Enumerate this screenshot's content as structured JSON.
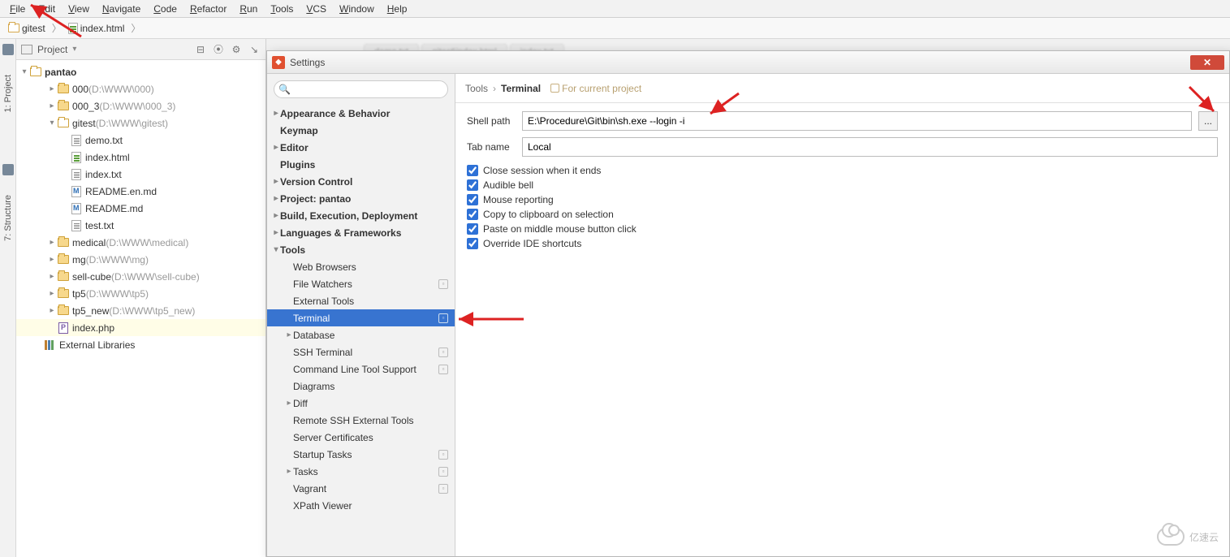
{
  "menubar": [
    "File",
    "Edit",
    "View",
    "Navigate",
    "Code",
    "Refactor",
    "Run",
    "Tools",
    "VCS",
    "Window",
    "Help"
  ],
  "breadcrumb": {
    "project": "gitest",
    "file": "index.html"
  },
  "leftrail": {
    "project": "1: Project",
    "structure": "7: Structure"
  },
  "project_panel": {
    "title": "Project",
    "root": "pantao",
    "items": [
      {
        "type": "folder",
        "arrow": "right",
        "name": "000",
        "hint": "(D:\\WWW\\000)",
        "indent": 1
      },
      {
        "type": "folder",
        "arrow": "right",
        "name": "000_3",
        "hint": "(D:\\WWW\\000_3)",
        "indent": 1
      },
      {
        "type": "folder",
        "arrow": "down",
        "name": "gitest",
        "hint": "(D:\\WWW\\gitest)",
        "indent": 1,
        "open": true
      },
      {
        "type": "file",
        "kind": "txt",
        "name": "demo.txt",
        "indent": 2
      },
      {
        "type": "file",
        "kind": "html",
        "name": "index.html",
        "indent": 2
      },
      {
        "type": "file",
        "kind": "txt",
        "name": "index.txt",
        "indent": 2
      },
      {
        "type": "file",
        "kind": "md",
        "name": "README.en.md",
        "indent": 2
      },
      {
        "type": "file",
        "kind": "md",
        "name": "README.md",
        "indent": 2
      },
      {
        "type": "file",
        "kind": "txt",
        "name": "test.txt",
        "indent": 2
      },
      {
        "type": "folder",
        "arrow": "right",
        "name": "medical",
        "hint": "(D:\\WWW\\medical)",
        "indent": 1
      },
      {
        "type": "folder",
        "arrow": "right",
        "name": "mg",
        "hint": "(D:\\WWW\\mg)",
        "indent": 1
      },
      {
        "type": "folder",
        "arrow": "right",
        "name": "sell-cube",
        "hint": "(D:\\WWW\\sell-cube)",
        "indent": 1
      },
      {
        "type": "folder",
        "arrow": "right",
        "name": "tp5",
        "hint": "(D:\\WWW\\tp5)",
        "indent": 1
      },
      {
        "type": "folder",
        "arrow": "right",
        "name": "tp5_new",
        "hint": "(D:\\WWW\\tp5_new)",
        "indent": 1
      },
      {
        "type": "file",
        "kind": "php",
        "name": "index.php",
        "indent": 1,
        "selected": true
      },
      {
        "type": "lib",
        "name": "External Libraries",
        "indent": 0
      }
    ]
  },
  "editor_tabs": [
    "demo.txt",
    "gitest\\index.html",
    "index.txt"
  ],
  "dialog": {
    "title": "Settings",
    "close": "✕",
    "search_placeholder": "",
    "nav": [
      {
        "label": "Appearance & Behavior",
        "bold": true,
        "arrow": "right",
        "ind": 0
      },
      {
        "label": "Keymap",
        "bold": true,
        "ind": 0
      },
      {
        "label": "Editor",
        "bold": true,
        "arrow": "right",
        "ind": 0
      },
      {
        "label": "Plugins",
        "bold": true,
        "ind": 0
      },
      {
        "label": "Version Control",
        "bold": true,
        "arrow": "right",
        "ind": 0
      },
      {
        "label": "Project: pantao",
        "bold": true,
        "arrow": "right",
        "ind": 0
      },
      {
        "label": "Build, Execution, Deployment",
        "bold": true,
        "arrow": "right",
        "ind": 0
      },
      {
        "label": "Languages & Frameworks",
        "bold": true,
        "arrow": "right",
        "ind": 0
      },
      {
        "label": "Tools",
        "bold": true,
        "arrow": "down",
        "ind": 0
      },
      {
        "label": "Web Browsers",
        "ind": 1
      },
      {
        "label": "File Watchers",
        "ind": 1,
        "badge": true
      },
      {
        "label": "External Tools",
        "ind": 1
      },
      {
        "label": "Terminal",
        "ind": 1,
        "badge": true,
        "sel": true
      },
      {
        "label": "Database",
        "arrow": "right",
        "ind": 1
      },
      {
        "label": "SSH Terminal",
        "ind": 1,
        "badge": true
      },
      {
        "label": "Command Line Tool Support",
        "ind": 1,
        "badge": true
      },
      {
        "label": "Diagrams",
        "ind": 1
      },
      {
        "label": "Diff",
        "arrow": "right",
        "ind": 1
      },
      {
        "label": "Remote SSH External Tools",
        "ind": 1
      },
      {
        "label": "Server Certificates",
        "ind": 1
      },
      {
        "label": "Startup Tasks",
        "ind": 1,
        "badge": true
      },
      {
        "label": "Tasks",
        "arrow": "right",
        "ind": 1,
        "badge": true
      },
      {
        "label": "Vagrant",
        "ind": 1,
        "badge": true
      },
      {
        "label": "XPath Viewer",
        "ind": 1
      }
    ],
    "content": {
      "crumb1": "Tools",
      "crumb2": "Terminal",
      "hint": "For current project",
      "shell_label": "Shell path",
      "shell_value": "E:\\Procedure\\Git\\bin\\sh.exe --login -i",
      "browse": "...",
      "tab_label": "Tab name",
      "tab_value": "Local",
      "checks": [
        "Close session when it ends",
        "Audible bell",
        "Mouse reporting",
        "Copy to clipboard on selection",
        "Paste on middle mouse button click",
        "Override IDE shortcuts"
      ]
    }
  },
  "watermark": "亿速云"
}
